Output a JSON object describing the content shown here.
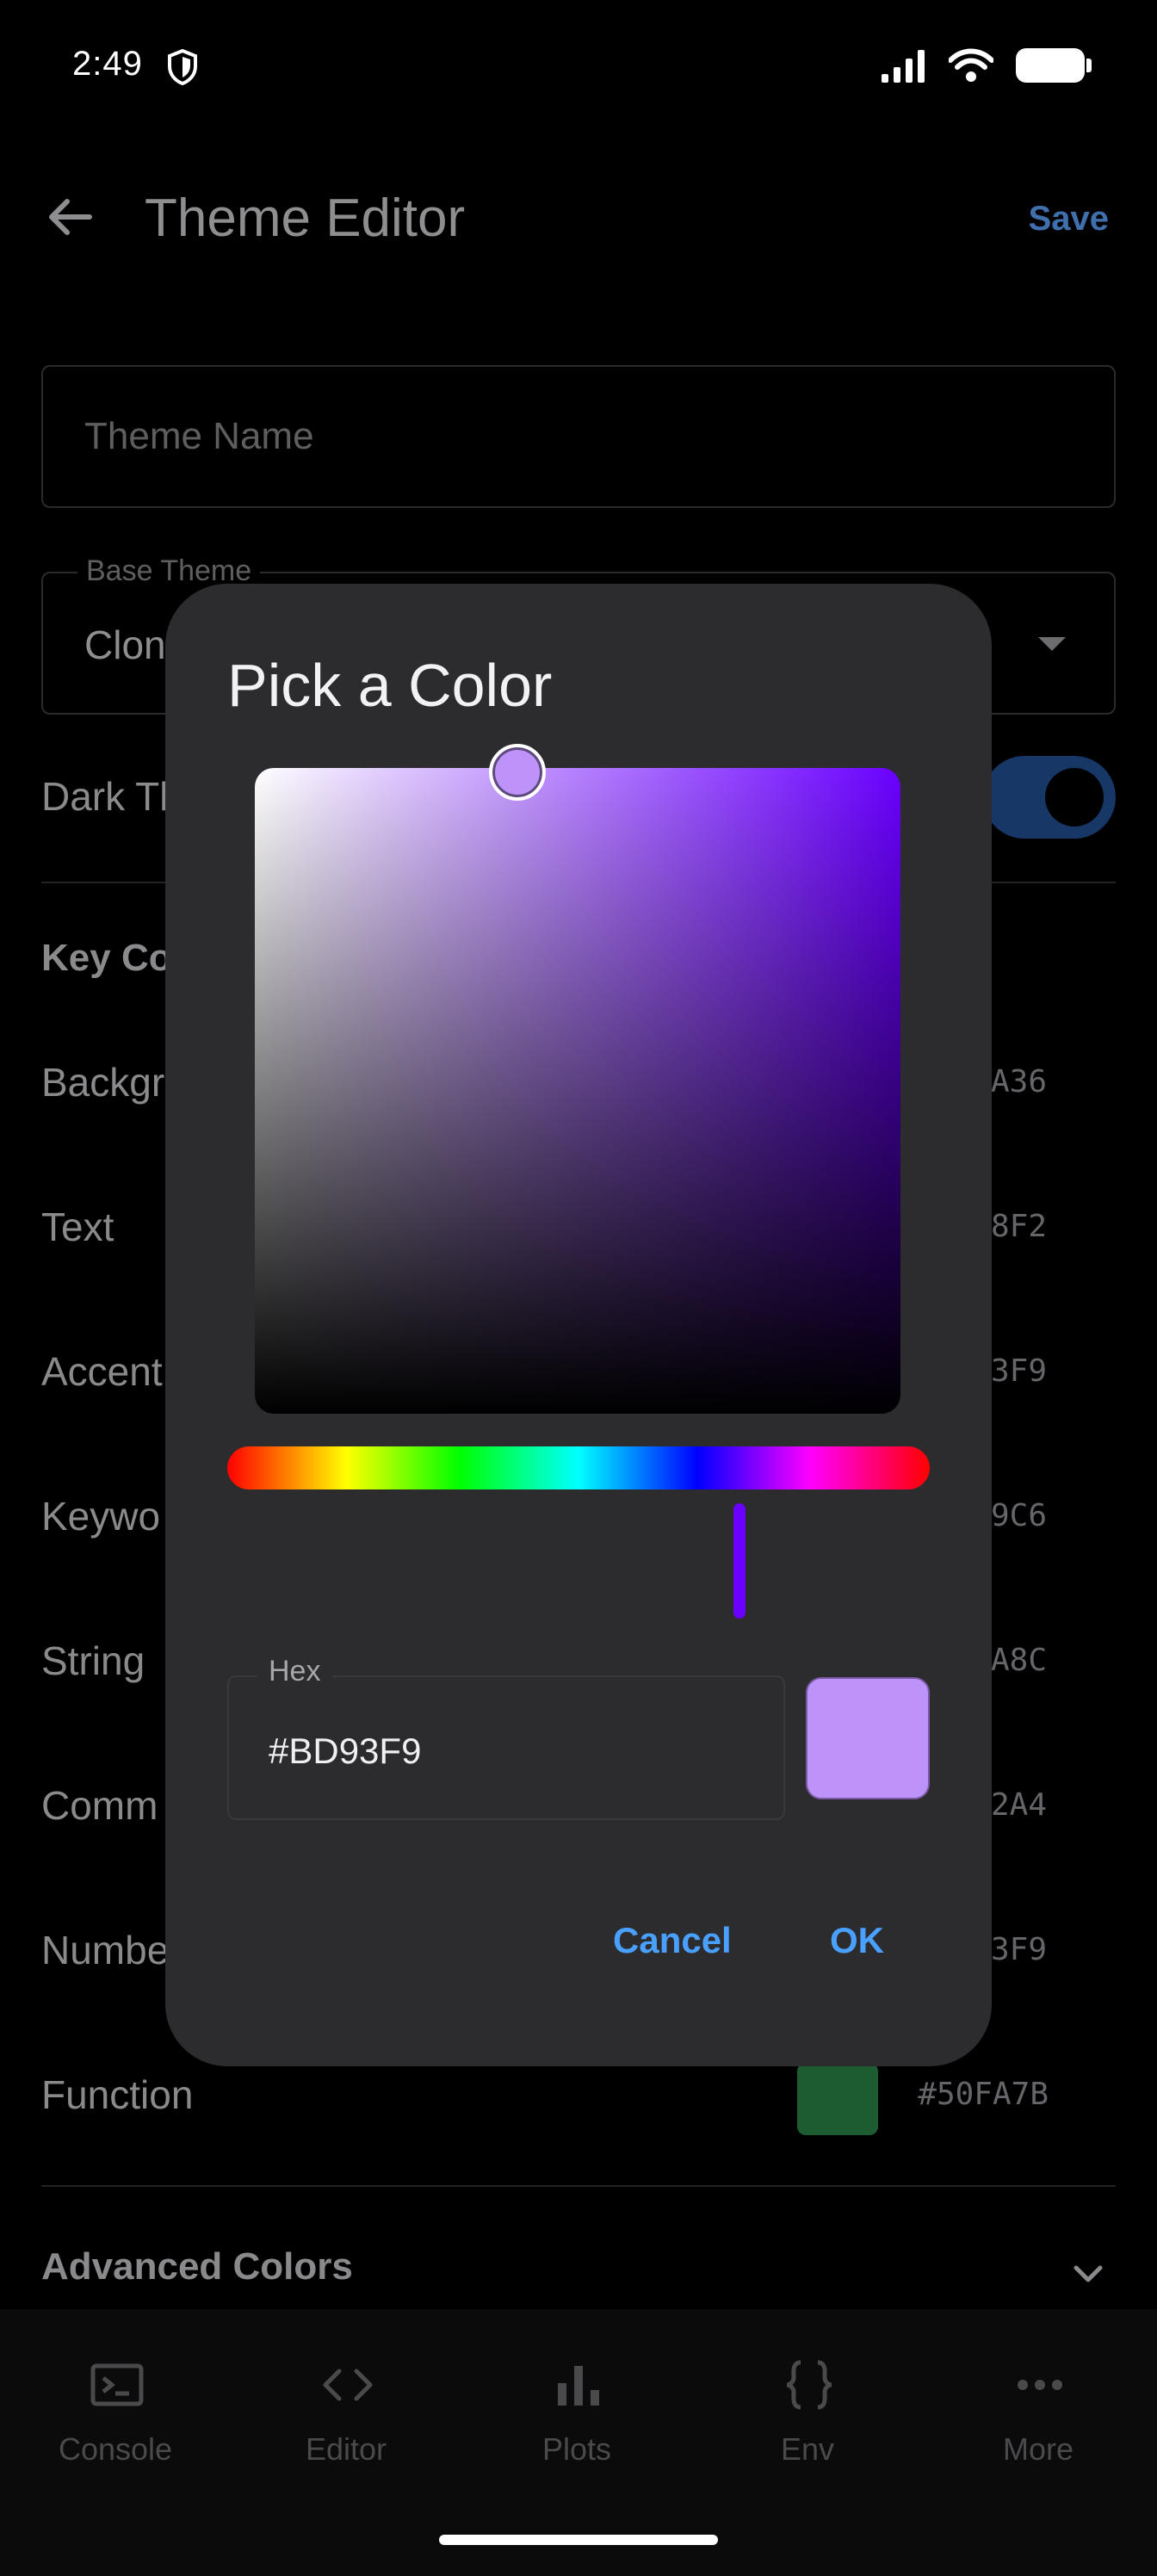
{
  "status_bar": {
    "time": "2:49"
  },
  "app_bar": {
    "title": "Theme Editor",
    "save_label": "Save"
  },
  "form": {
    "theme_name_placeholder": "Theme Name",
    "base_theme_label": "Base Theme",
    "base_theme_value": "Clon",
    "dark_theme_label": "Dark Th",
    "key_colors_header": "Key Co",
    "advanced_colors_header": "Advanced Colors"
  },
  "rows": [
    {
      "label": "Backgr",
      "hex": "A36"
    },
    {
      "label": "Text",
      "hex": "8F2"
    },
    {
      "label": "Accent",
      "hex": "3F9"
    },
    {
      "label": "Keywo",
      "hex": "9C6"
    },
    {
      "label": "String",
      "hex": "A8C"
    },
    {
      "label": "Comm",
      "hex": "2A4"
    },
    {
      "label": "Numbe",
      "hex": "3F9"
    },
    {
      "label": "Function",
      "hex": "#50FA7B"
    }
  ],
  "dialog": {
    "title": "Pick a Color",
    "hex_label": "Hex",
    "hex_value": "#BD93F9",
    "cancel_label": "Cancel",
    "ok_label": "OK",
    "selected_color": "#BD93F9"
  },
  "bottom_nav": [
    {
      "label": "Console",
      "icon": "console-icon"
    },
    {
      "label": "Editor",
      "icon": "code-icon"
    },
    {
      "label": "Plots",
      "icon": "bar-chart-icon"
    },
    {
      "label": "Env",
      "icon": "braces-icon"
    },
    {
      "label": "More",
      "icon": "more-dots-icon"
    }
  ]
}
